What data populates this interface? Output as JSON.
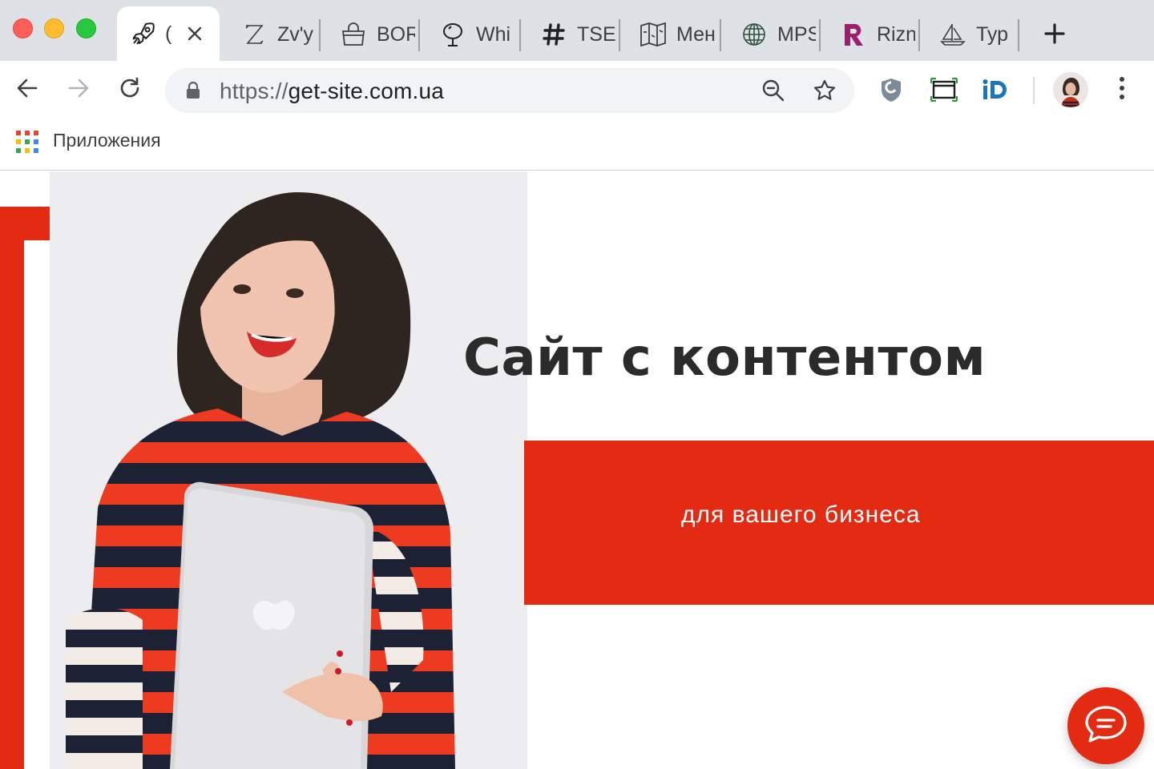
{
  "browser": {
    "tabs": [
      {
        "label": "(",
        "icon": "rocket-icon",
        "active": true
      },
      {
        "label": "Zv'y",
        "icon": "z-letter-icon"
      },
      {
        "label": "BOR",
        "icon": "shopping-bag-icon"
      },
      {
        "label": "Whi",
        "icon": "mirror-icon"
      },
      {
        "label": "TSE",
        "icon": "hash-icon"
      },
      {
        "label": "Мен",
        "icon": "map-icon"
      },
      {
        "label": "MPS",
        "icon": "globe-icon"
      },
      {
        "label": "Rizn",
        "icon": "r-logo-icon"
      },
      {
        "label": "Тур",
        "icon": "sailboat-icon"
      }
    ],
    "new_tab_icon": "plus-icon",
    "address": {
      "scheme": "https://",
      "host": "get-site.com.ua"
    },
    "bookmarks": {
      "apps_label": "Приложения"
    },
    "colors": {
      "tabstrip": "#dee1e6",
      "omnibox": "#f1f3f4"
    }
  },
  "page": {
    "headline": "Сайт с контентом",
    "subline": "для вашего бизнеса",
    "accent_color": "#e32b13",
    "chat_icon": "chat-bubble-icon"
  }
}
